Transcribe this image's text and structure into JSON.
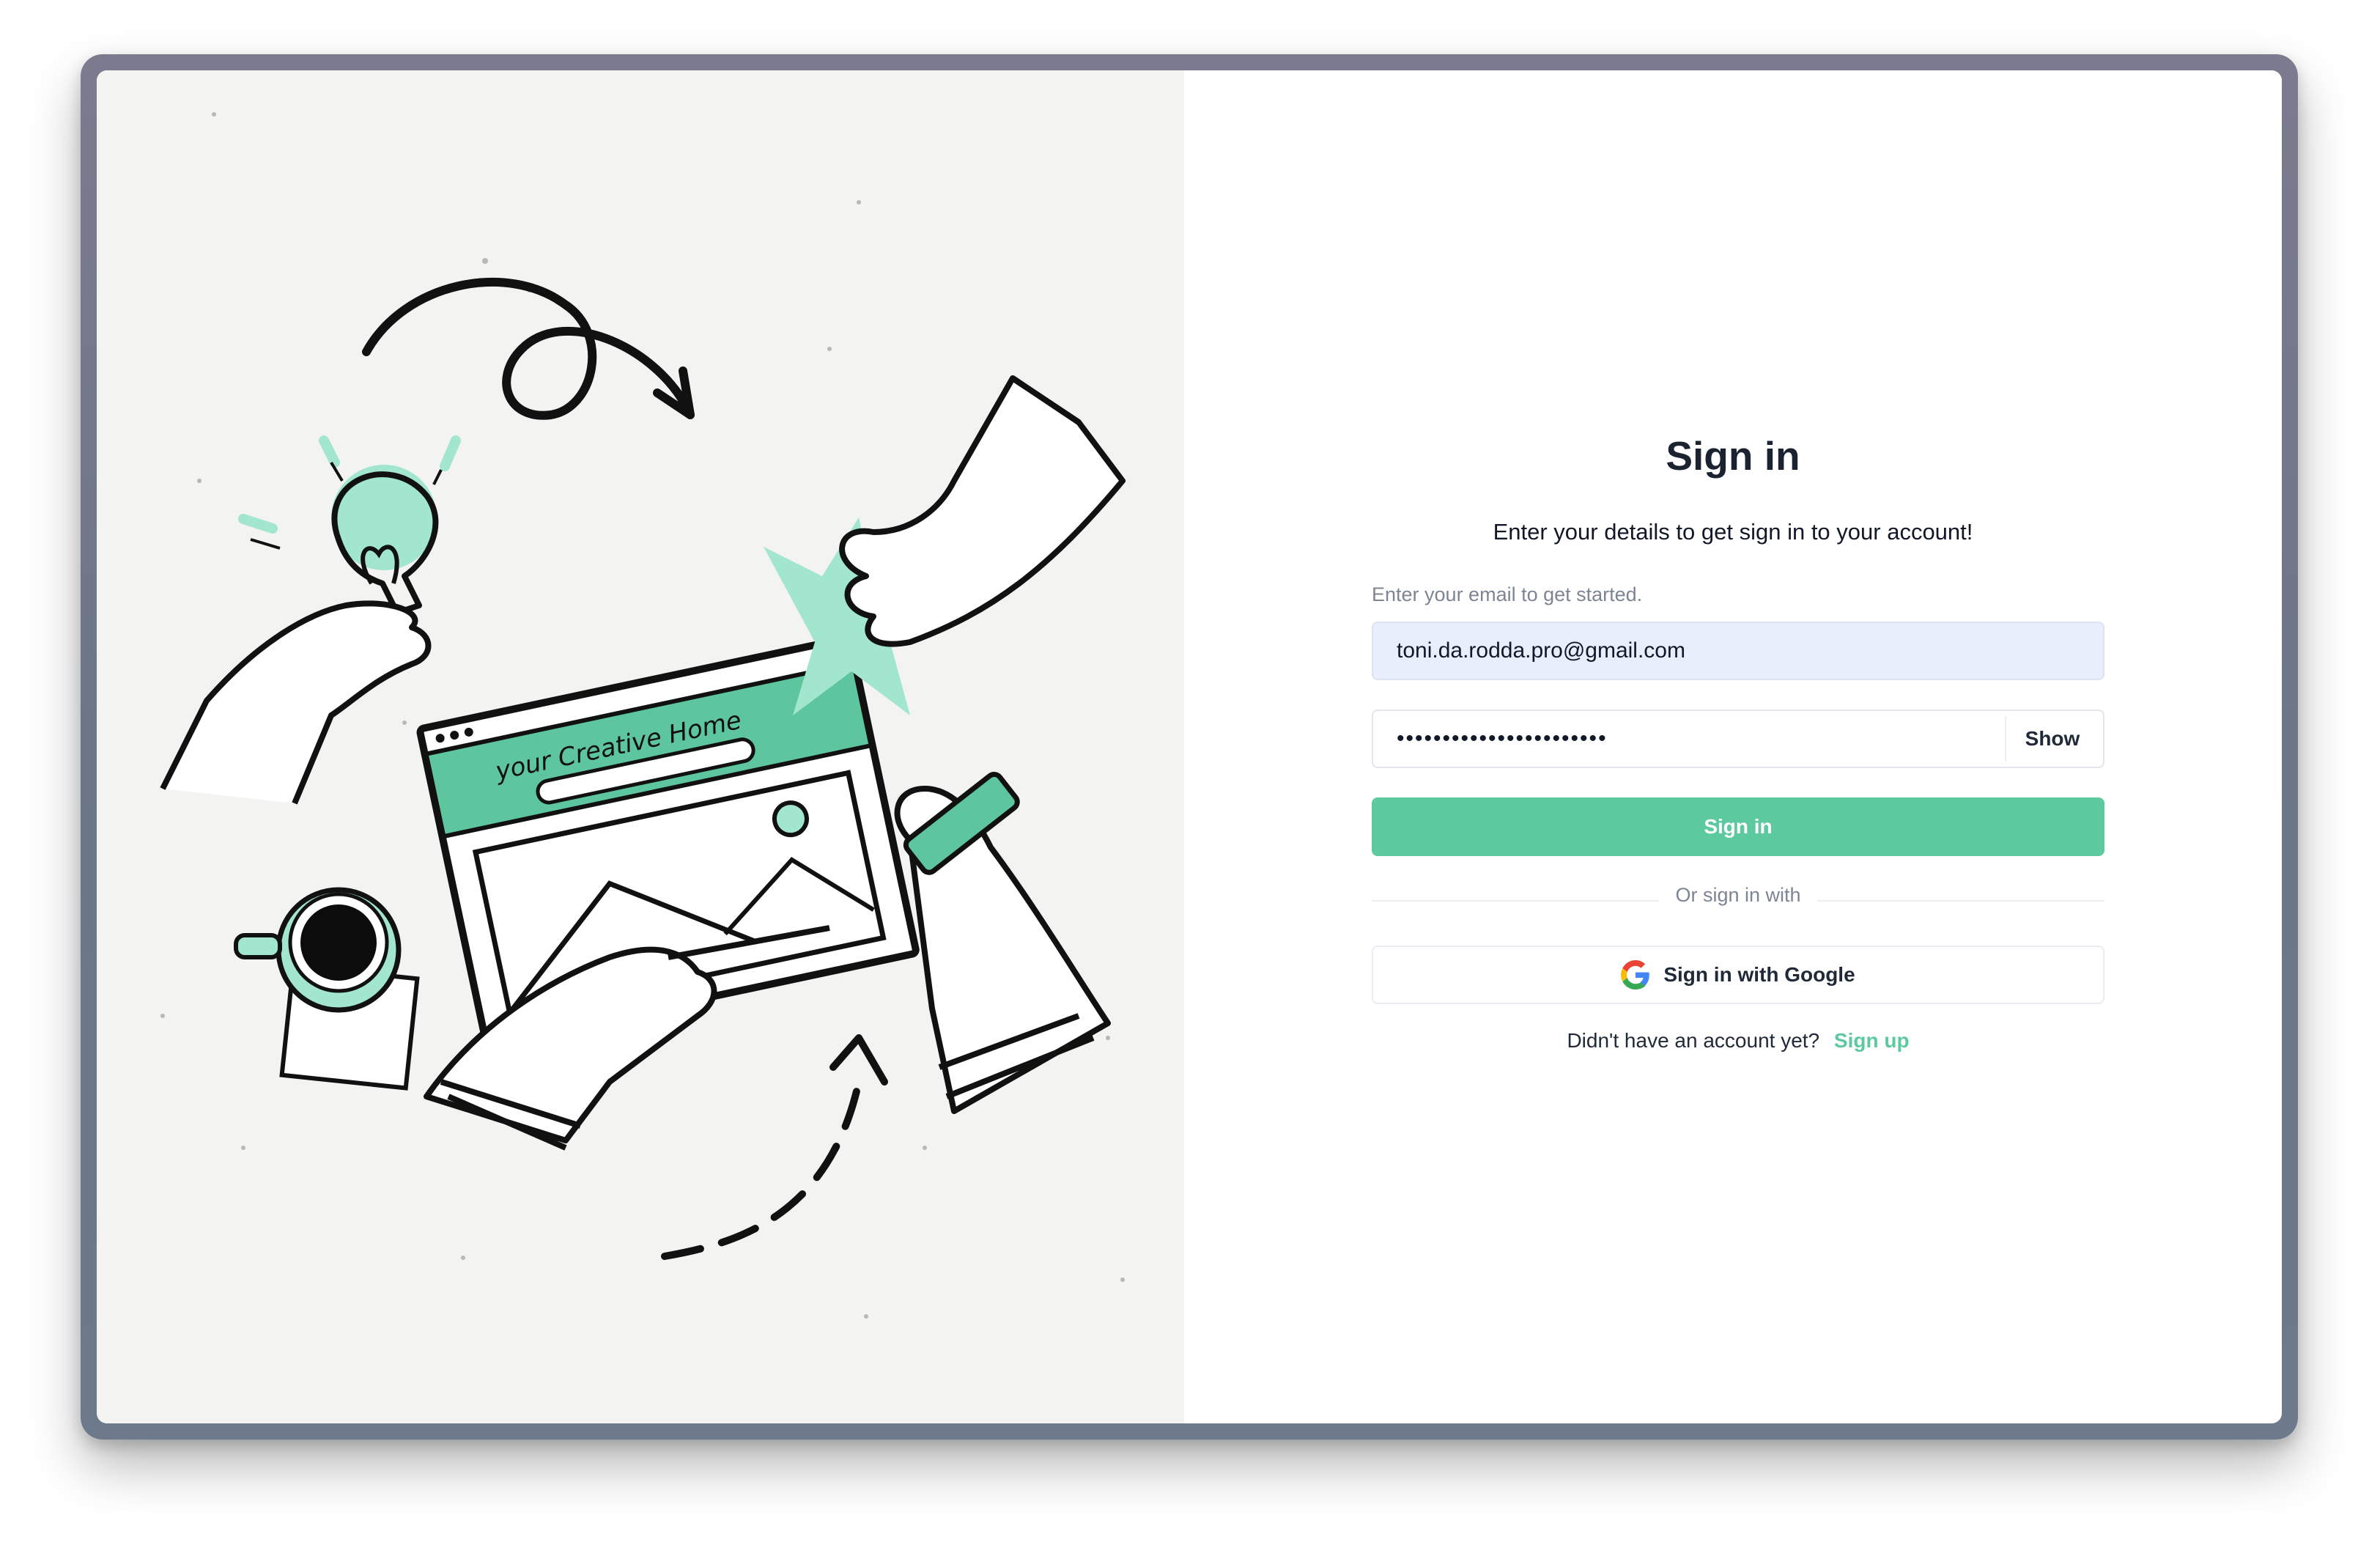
{
  "illustration": {
    "banner_text": "your Creative Home",
    "alt": "Illustration of hands working on a laptop with lightbulb, star, pen and coffee cup"
  },
  "signin": {
    "title": "Sign in",
    "subtitle": "Enter your details to get sign in to your account!",
    "email_helper": "Enter your email to get started.",
    "email_value": "toni.da.rodda.pro@gmail.com",
    "password_value": "•••••••••••••••••••••••",
    "show_label": "Show",
    "signin_button_label": "Sign in",
    "divider_text": "Or sign in with",
    "google_button_label": "Sign in with Google",
    "google_icon": "google-g-logo",
    "no_account_text": "Didn't have an account yet?",
    "signup_link_label": "Sign up"
  },
  "colors": {
    "accent": "#5dc99f",
    "illustration_mint": "#a3e6cf",
    "illustration_green": "#5ec69e",
    "email_fill": "#e8eefb"
  }
}
